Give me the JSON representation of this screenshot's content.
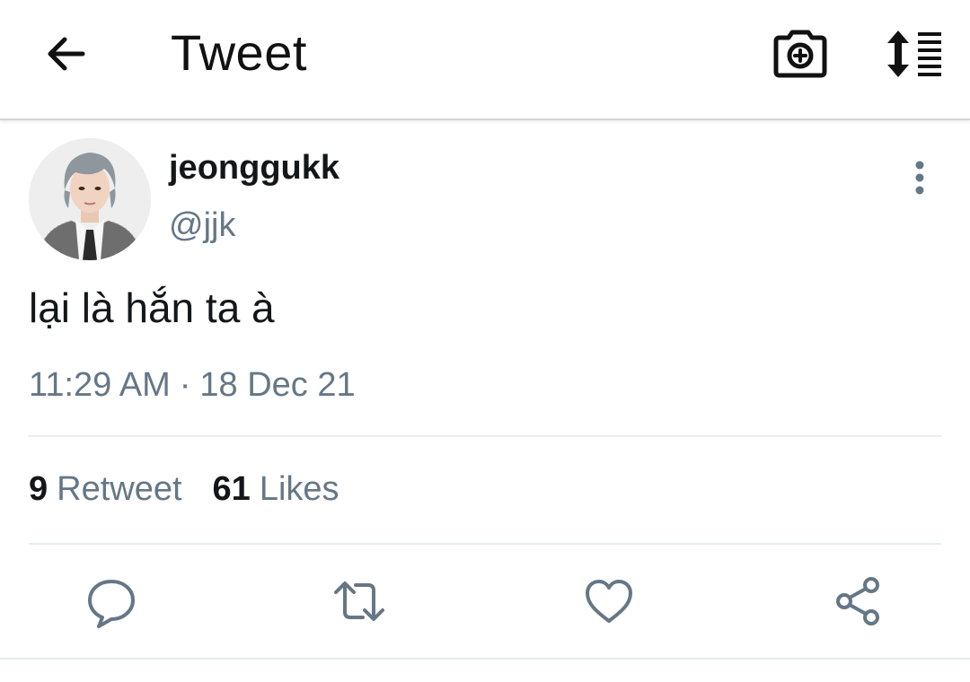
{
  "header": {
    "title": "Tweet",
    "icons": {
      "back": "arrow-left-icon",
      "camera": "camera-plus-icon",
      "sort": "sort-list-icon"
    }
  },
  "tweet": {
    "display_name": "jeonggukk",
    "handle": "@jjk",
    "text": "lại là hắn ta à",
    "time": "11:29 AM",
    "separator": "·",
    "date": "18 Dec 21",
    "stats": {
      "retweets_count": "9",
      "retweets_label": "Retweet",
      "likes_count": "61",
      "likes_label": "Likes"
    }
  },
  "actions": [
    "reply-icon",
    "retweet-icon",
    "like-icon",
    "share-icon"
  ],
  "colors": {
    "secondary_text": "#657786",
    "icon": "#657786",
    "primary_text": "#14171a",
    "divider": "#e6ecf0"
  }
}
